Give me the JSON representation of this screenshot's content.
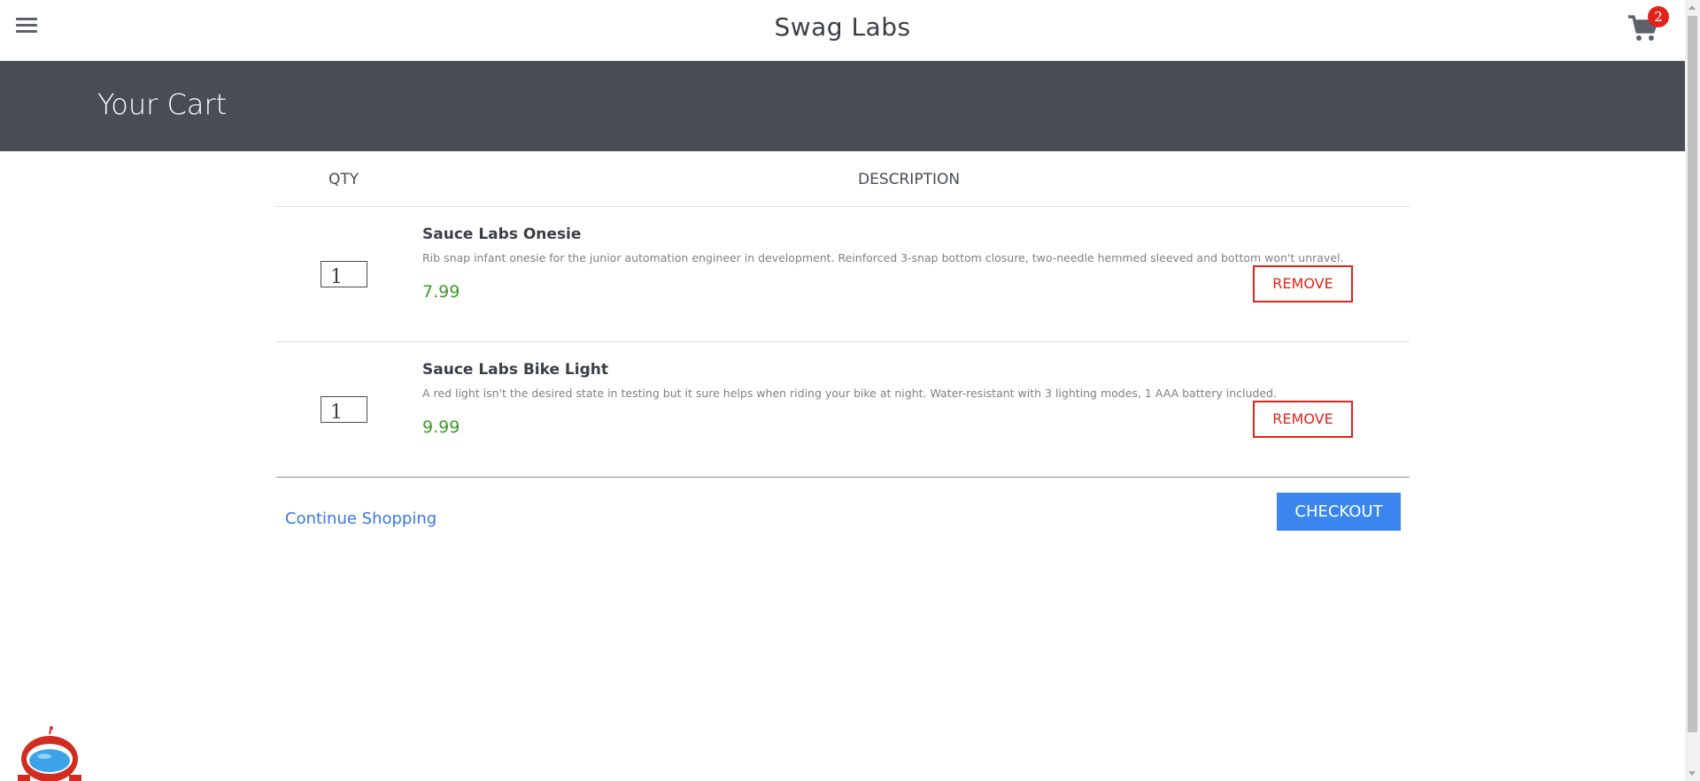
{
  "header": {
    "app_title": "Swag Labs",
    "cart_count": "2"
  },
  "subheader": {
    "title": "Your Cart"
  },
  "cart": {
    "columns": {
      "qty": "QTY",
      "description": "DESCRIPTION"
    },
    "items": [
      {
        "quantity": "1",
        "name": "Sauce Labs Onesie",
        "description": "Rib snap infant onesie for the junior automation engineer in development. Reinforced 3-snap bottom closure, two-needle hemmed sleeved and bottom won't unravel.",
        "price": "7.99",
        "remove_label": "REMOVE"
      },
      {
        "quantity": "1",
        "name": "Sauce Labs Bike Light",
        "description": "A red light isn't the desired state in testing but it sure helps when riding your bike at night. Water-resistant with 3 lighting modes, 1 AAA battery included.",
        "price": "9.99",
        "remove_label": "REMOVE"
      }
    ],
    "continue_label": "Continue Shopping",
    "checkout_label": "CHECKOUT"
  },
  "colors": {
    "subheader_bg": "#474c55",
    "price": "#3d9b24",
    "remove": "#e2231a",
    "checkout": "#3a86ee",
    "link": "#3878e0",
    "badge": "#e2231a"
  },
  "icons": {
    "menu": "hamburger-menu-icon",
    "cart": "shopping-cart-icon",
    "robot": "robot-mascot-icon"
  }
}
